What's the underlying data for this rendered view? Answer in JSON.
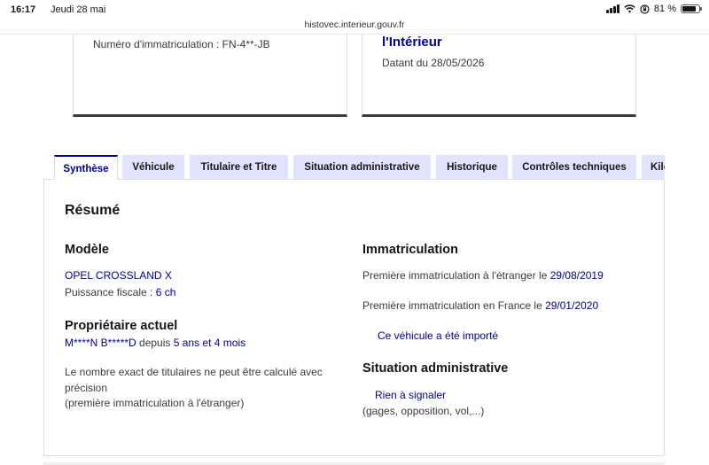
{
  "status_bar": {
    "time": "16:17",
    "date": "Jeudi 28 mai",
    "battery": "81 %",
    "battery_level": 0.81,
    "url": "histovec.interieur.gouv.fr"
  },
  "cards": {
    "left": {
      "plate": "Numéro d'immatriculation : FN-4**-JB"
    },
    "right": {
      "title": "l'Intérieur",
      "date": "Datant du 28/05/2026"
    }
  },
  "tabs": [
    {
      "label": "Synthèse",
      "active": true
    },
    {
      "label": "Véhicule"
    },
    {
      "label": "Titulaire et Titre"
    },
    {
      "label": "Situation administrative"
    },
    {
      "label": "Historique"
    },
    {
      "label": "Contrôles techniques"
    },
    {
      "label": "Kilométrage"
    }
  ],
  "summary": {
    "heading": "Résumé",
    "model": {
      "heading": "Modèle",
      "name": "OPEL CROSSLAND X",
      "power_label": "Puissance fiscale : ",
      "power_value": "6 ch"
    },
    "owner": {
      "heading": "Propriétaire actuel",
      "name": "M****N B*****D",
      "since_label": " depuis ",
      "since_value": "5 ans et 4 mois",
      "note_line1": "Le nombre exact de titulaires ne peut être calculé avec",
      "note_line2": "précision",
      "note_line3": "(première immatriculation à l'étranger)"
    },
    "registration": {
      "heading": "Immatriculation",
      "foreign_label": "Première immatriculation à l'étranger le ",
      "foreign_date": "29/08/2019",
      "france_label": "Première immatriculation en France le ",
      "france_date": "29/01/2020",
      "imported_link": "Ce véhicule a été importé"
    },
    "admin": {
      "heading": "Situation administrative",
      "status_link": "Rien à signaler",
      "details": "(gages, opposition, vol,...)"
    }
  }
}
